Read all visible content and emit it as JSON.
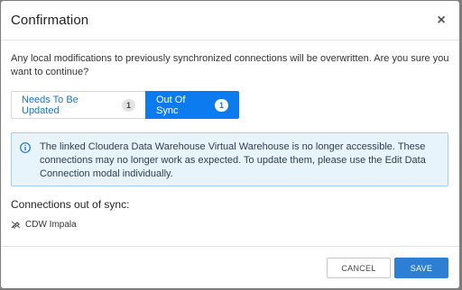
{
  "dialog": {
    "title": "Confirmation",
    "close_label": "×",
    "message": "Any local modifications to previously synchronized connections will be overwritten. Are you sure you want to continue?"
  },
  "tabs": [
    {
      "label": "Needs To Be Updated",
      "count": "1",
      "active": false
    },
    {
      "label": "Out Of Sync",
      "count": "1",
      "active": true
    }
  ],
  "info": {
    "icon": "info-circle-icon",
    "text": "The linked Cloudera Data Warehouse Virtual Warehouse is no longer accessible. These connections may no longer work as expected. To update them, please use the Edit Data Connection modal individually."
  },
  "connections": {
    "heading": "Connections out of sync:",
    "items": [
      {
        "icon": "disconnected-icon",
        "name": "CDW Impala"
      }
    ]
  },
  "footer": {
    "cancel_label": "CANCEL",
    "save_label": "SAVE"
  },
  "colors": {
    "accent": "#0d7bf0",
    "save_button": "#2e7fd4",
    "info_background": "#e8f4fc",
    "info_border": "#9fd0ee"
  }
}
